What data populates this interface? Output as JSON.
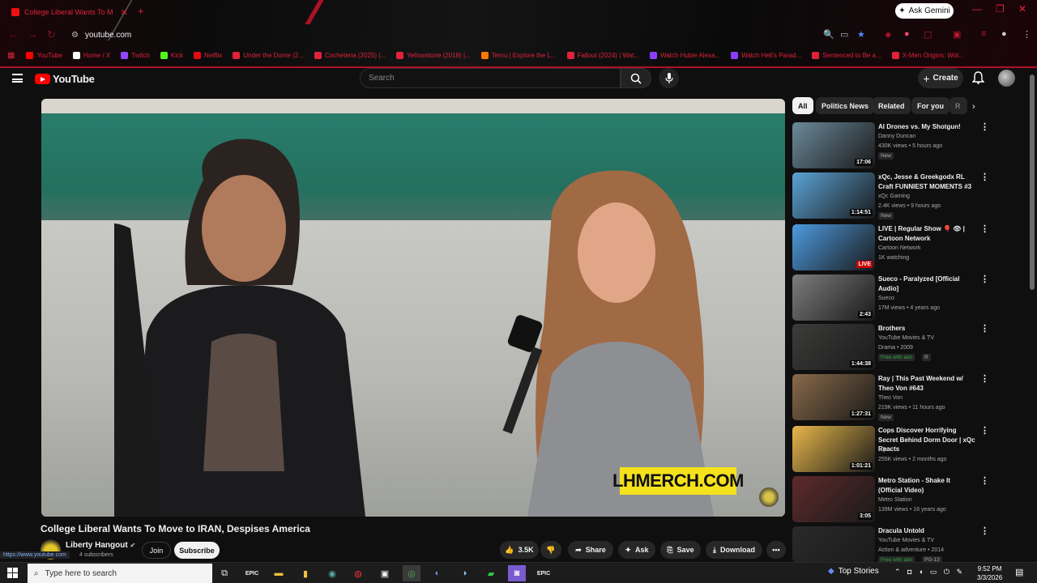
{
  "browser": {
    "tab_title": "College Liberal Wants To M",
    "tab_close": "✕",
    "new_tab": "+",
    "ask_gemini": "Ask Gemini",
    "url": "youtube.com",
    "bookmarks": [
      {
        "label": "YouTube",
        "color": "#ff0000"
      },
      {
        "label": "Home / X",
        "color": "#ffffff"
      },
      {
        "label": "Twitch",
        "color": "#9146ff"
      },
      {
        "label": "Kick",
        "color": "#53fc18"
      },
      {
        "label": "Netflix",
        "color": "#e50914"
      },
      {
        "label": "Under the Dome (2...",
        "color": "#e0223a"
      },
      {
        "label": "Cocheteria (2025) |...",
        "color": "#e0223a"
      },
      {
        "label": "Yellowstone (2018) |...",
        "color": "#e0223a"
      },
      {
        "label": "Temu | Explore the L...",
        "color": "#fb7701"
      },
      {
        "label": "Fallout (2024) | Wat...",
        "color": "#e0223a"
      },
      {
        "label": "Watch Hubie Alexa...",
        "color": "#8b3dff"
      },
      {
        "label": "Watch Hell's Parad...",
        "color": "#8b3dff"
      },
      {
        "label": "Sentenced to Be a...",
        "color": "#e0223a"
      },
      {
        "label": "X-Men Origins: Wol...",
        "color": "#e0223a"
      }
    ],
    "status_url": "https://www.youtube.com"
  },
  "youtube": {
    "logo_text": "YouTube",
    "search_placeholder": "Search",
    "create_label": "Create",
    "video": {
      "overlay_text": "LHMERCH.COM",
      "title": "College Liberal Wants To Move to IRAN, Despises America",
      "channel": "Liberty Hangout",
      "subscribers": "4 subscribers",
      "join_label": "Join",
      "subscribe_label": "Subscribe",
      "likes": "3.5K",
      "share_label": "Share",
      "ask_label": "Ask",
      "save_label": "Save",
      "download_label": "Download"
    },
    "chips": [
      "All",
      "Politics News",
      "Related",
      "For you",
      "R"
    ],
    "recommendations": [
      {
        "title": "AI Drones vs. My Shotgun!",
        "channel": "Danny Duncan",
        "meta": "430K views • 5 hours ago",
        "badge": "New",
        "duration": "17:06",
        "thumb": "#6b8a9a"
      },
      {
        "title": "xQc, Jesse & Greekgodx RL Craft FUNNIEST MOMENTS #3",
        "channel": "xQc Gaming",
        "meta": "2.4K views • 9 hours ago",
        "badge": "New",
        "duration": "1:14:51",
        "thumb": "#5aa3d6"
      },
      {
        "title": "LIVE | Regular Show 🎈 👁 | Cartoon Network",
        "channel": "Cartoon Network",
        "meta": "1K watching",
        "badge": "",
        "duration": "LIVE",
        "thumb": "#4d9be0"
      },
      {
        "title": "Sueco - Paralyzed [Official Audio]",
        "channel": "Sueco",
        "meta": "17M views • 4 years ago",
        "badge": "",
        "duration": "2:43",
        "thumb": "#7d7d7d"
      },
      {
        "title": "Brothers",
        "channel": "YouTube Movies & TV",
        "meta": "Drama • 2009",
        "badge": "Free with ads",
        "badge2": "R",
        "duration": "1:44:38",
        "thumb": "#3b3d3a"
      },
      {
        "title": "Ray | This Past Weekend w/ Theo Von #643",
        "channel": "Theo Von",
        "meta": "219K views • 11 hours ago",
        "badge": "New",
        "duration": "1:27:31",
        "thumb": "#8a6a4a"
      },
      {
        "title": "Cops Discover Horrifying Secret Behind Dorm Door | xQc Reacts",
        "channel": "xQc",
        "meta": "255K views • 2 months ago",
        "badge": "",
        "duration": "1:01:21",
        "thumb": "#e9b84a"
      },
      {
        "title": "Metro Station - Shake It (Official Video)",
        "channel": "Metro Station",
        "meta": "139M views • 16 years ago",
        "badge": "",
        "duration": "3:05",
        "thumb": "#5e2a2a"
      },
      {
        "title": "Dracula Untold",
        "channel": "YouTube Movies & TV",
        "meta": "Action & adventure • 2014",
        "badge": "Free with ads",
        "badge2": "PG-13",
        "duration": "",
        "thumb": "#2a2a2a"
      }
    ]
  },
  "taskbar": {
    "search_placeholder": "Type here to search",
    "news_label": "Top Stories",
    "time": "9:52 PM",
    "date": "3/3/2026"
  },
  "colors": {
    "accent_red": "#e0223a",
    "yt_red": "#ff0000",
    "bg": "#0f0f0f"
  }
}
